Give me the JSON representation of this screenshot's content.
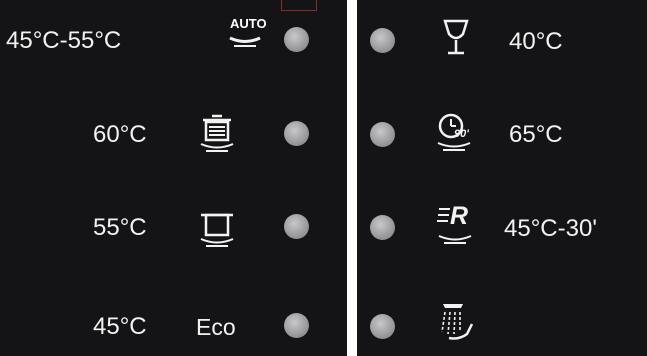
{
  "left_panel": {
    "programs": [
      {
        "temp": "45°C-55°C",
        "icon": "auto-icon",
        "icon_text": "AUTO"
      },
      {
        "temp": "60°C",
        "icon": "heavy-pot-icon"
      },
      {
        "temp": "55°C",
        "icon": "pot-icon"
      },
      {
        "temp": "45°C",
        "icon": "eco-icon",
        "icon_text": "Eco"
      }
    ]
  },
  "right_panel": {
    "programs": [
      {
        "temp": "40°C",
        "icon": "glass-icon"
      },
      {
        "temp": "65°C",
        "icon": "clock-90-icon",
        "icon_text": "90'"
      },
      {
        "temp": "45°C-30'",
        "icon": "rapid-icon",
        "icon_text": "R"
      },
      {
        "temp": "",
        "icon": "rinse-icon"
      }
    ]
  },
  "colors": {
    "panel_background": "#141416",
    "text": "#f2f2f2",
    "indicator": "#9d9da1",
    "frame": "#8a2a2a"
  }
}
